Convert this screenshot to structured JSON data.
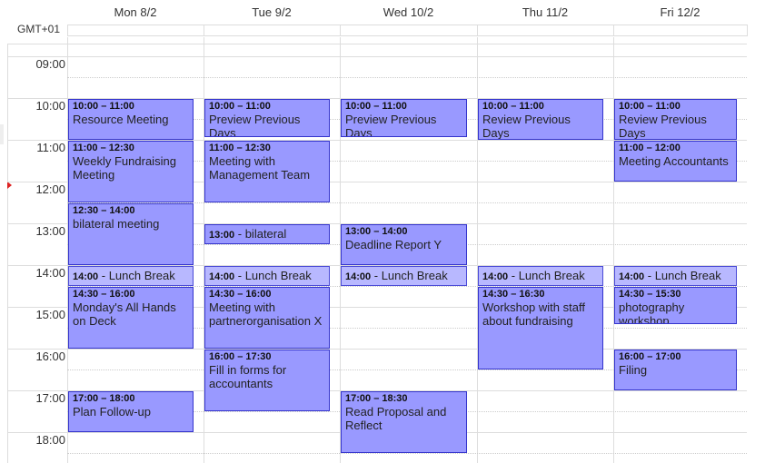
{
  "calendar": {
    "timezone": "GMT+01",
    "days": [
      {
        "label": "Mon 8/2"
      },
      {
        "label": "Tue 9/2"
      },
      {
        "label": "Wed 10/2"
      },
      {
        "label": "Thu 11/2"
      },
      {
        "label": "Fri 12/2"
      }
    ],
    "hours": [
      "09:00",
      "10:00",
      "11:00",
      "12:00",
      "13:00",
      "14:00",
      "15:00",
      "16:00",
      "17:00",
      "18:00"
    ],
    "event_color": "#9999ff",
    "event_light_color": "#b8b8ff",
    "event_border_color": "#3333cc",
    "events": [
      {
        "day": 0,
        "start": 10,
        "end": 11,
        "time": "10:00 – 11:00",
        "title": "Resource Meeting"
      },
      {
        "day": 0,
        "start": 11,
        "end": 12.5,
        "time": "11:00 – 12:30",
        "title": "Weekly Fundraising Meeting"
      },
      {
        "day": 0,
        "start": 12.5,
        "end": 14,
        "time": "12:30 – 14:00",
        "title": "bilateral meeting"
      },
      {
        "day": 0,
        "start": 14,
        "end": 14.5,
        "time": "14:00",
        "title": "Lunch Break",
        "inline": true,
        "light": true
      },
      {
        "day": 0,
        "start": 14.5,
        "end": 16,
        "time": "14:30 – 16:00",
        "title": "Monday's All Hands on Deck"
      },
      {
        "day": 0,
        "start": 17,
        "end": 18,
        "time": "17:00 – 18:00",
        "title": "Plan Follow-up"
      },
      {
        "day": 1,
        "start": 10,
        "end": 11,
        "time": "10:00 – 11:00",
        "title": "Preview Previous Days"
      },
      {
        "day": 1,
        "start": 11,
        "end": 12.5,
        "time": "11:00 – 12:30",
        "title": "Meeting with Management Team"
      },
      {
        "day": 1,
        "start": 13,
        "end": 13.5,
        "time": "13:00",
        "title": "bilateral",
        "inline": true
      },
      {
        "day": 1,
        "start": 14,
        "end": 14.5,
        "time": "14:00",
        "title": "Lunch Break",
        "inline": true,
        "light": true
      },
      {
        "day": 1,
        "start": 14.5,
        "end": 16,
        "time": "14:30 – 16:00",
        "title": "Meeting with partnerorganisation X"
      },
      {
        "day": 1,
        "start": 16,
        "end": 17.5,
        "time": "16:00 – 17:30",
        "title": "Fill in forms for accountants"
      },
      {
        "day": 2,
        "start": 10,
        "end": 11,
        "time": "10:00 – 11:00",
        "title": "Preview Previous Days"
      },
      {
        "day": 2,
        "start": 13,
        "end": 14,
        "time": "13:00 – 14:00",
        "title": "Deadline Report Y"
      },
      {
        "day": 2,
        "start": 14,
        "end": 14.5,
        "time": "14:00",
        "title": "Lunch Break",
        "inline": true,
        "light": true
      },
      {
        "day": 2,
        "start": 17,
        "end": 18.5,
        "time": "17:00 – 18:30",
        "title": "Read Proposal and Reflect"
      },
      {
        "day": 3,
        "start": 10,
        "end": 11,
        "time": "10:00 – 11:00",
        "title": "Review Previous Days"
      },
      {
        "day": 3,
        "start": 14,
        "end": 14.5,
        "time": "14:00",
        "title": "Lunch Break",
        "inline": true,
        "light": true
      },
      {
        "day": 3,
        "start": 14.5,
        "end": 16.5,
        "time": "14:30 – 16:30",
        "title": "Workshop with staff about fundraising"
      },
      {
        "day": 4,
        "start": 10,
        "end": 11,
        "time": "10:00 – 11:00",
        "title": "Review Previous Days"
      },
      {
        "day": 4,
        "start": 11,
        "end": 12,
        "time": "11:00 – 12:00",
        "title": "Meeting Accountants"
      },
      {
        "day": 4,
        "start": 14,
        "end": 14.5,
        "time": "14:00",
        "title": "Lunch Break",
        "inline": true,
        "light": true
      },
      {
        "day": 4,
        "start": 14.5,
        "end": 15.5,
        "time": "14:30 – 15:30",
        "title": "photography workshop"
      },
      {
        "day": 4,
        "start": 16,
        "end": 17,
        "time": "16:00 – 17:00",
        "title": "Filing"
      }
    ]
  }
}
